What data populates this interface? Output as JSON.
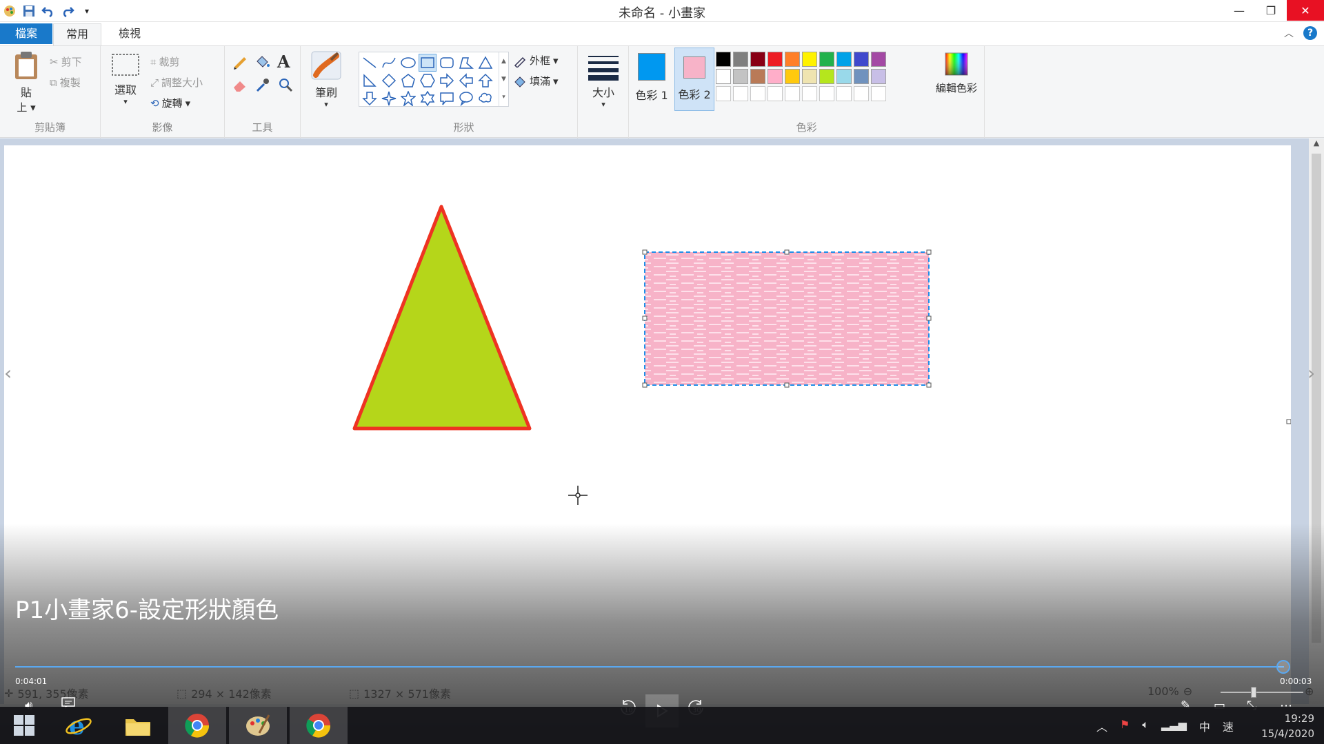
{
  "window": {
    "title": "未命名 - 小畫家"
  },
  "tabs": {
    "file": "檔案",
    "home": "常用",
    "view": "檢視"
  },
  "clipboard": {
    "paste": "貼",
    "paste2": "上",
    "cut": "剪下",
    "copy": "複製",
    "label": "剪貼簿"
  },
  "image": {
    "select": "選取",
    "crop": "裁剪",
    "resize": "調整大小",
    "rotate": "旋轉",
    "label": "影像"
  },
  "tools": {
    "label": "工具"
  },
  "brushes": {
    "label": "筆刷"
  },
  "shapes": {
    "outline": "外框",
    "fill": "填滿",
    "label": "形狀"
  },
  "size": {
    "label": "大小"
  },
  "colors": {
    "color1": "色彩 1",
    "color2": "色彩 2",
    "edit": "編輯色彩",
    "label": "色彩",
    "color1_value": "#0098f0",
    "color2_value": "#f7b3c8",
    "palette_row1": [
      "#000000",
      "#7f7f7f",
      "#880015",
      "#ed1c24",
      "#ff7f27",
      "#fff200",
      "#22b14c",
      "#00a2e8",
      "#3f48cc",
      "#a349a4"
    ],
    "palette_row2": [
      "#ffffff",
      "#c3c3c3",
      "#b97a57",
      "#ffaec9",
      "#ffc90e",
      "#efe4b0",
      "#b5e61d",
      "#99d9ea",
      "#7092be",
      "#c8bfe7"
    ]
  },
  "canvas_shapes": {
    "triangle_fill": "#b5d61a",
    "triangle_outline": "#ee3322",
    "rectangle_fill": "#f7b3c8",
    "selection_color": "#1e8ee8"
  },
  "video": {
    "title": "P1小畫家6-設定形狀顏色",
    "elapsed": "0:04:01",
    "remaining": "0:00:03",
    "rewind": "10",
    "forward": "30",
    "progress": 0.99
  },
  "status": {
    "cursor": "591, 355像素",
    "selection": "294 × 142像素",
    "image_size": "1327 × 571像素",
    "zoom": "100%"
  },
  "taskbar": {
    "time": "19:29",
    "date": "15/4/2020",
    "ime": "中",
    "ime2": "速"
  }
}
